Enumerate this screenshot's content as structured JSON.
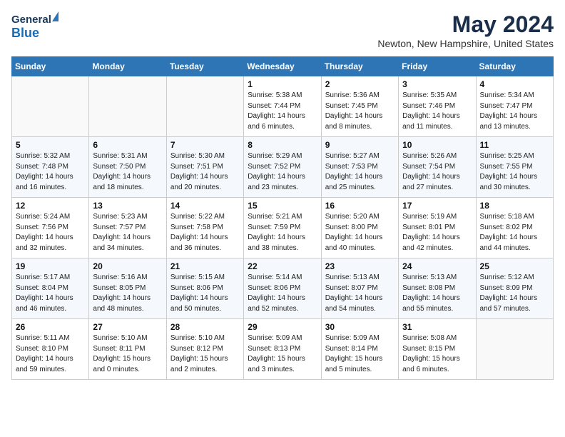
{
  "header": {
    "logo_general": "General",
    "logo_blue": "Blue",
    "month": "May 2024",
    "location": "Newton, New Hampshire, United States"
  },
  "weekdays": [
    "Sunday",
    "Monday",
    "Tuesday",
    "Wednesday",
    "Thursday",
    "Friday",
    "Saturday"
  ],
  "weeks": [
    [
      {
        "day": "",
        "detail": ""
      },
      {
        "day": "",
        "detail": ""
      },
      {
        "day": "",
        "detail": ""
      },
      {
        "day": "1",
        "detail": "Sunrise: 5:38 AM\nSunset: 7:44 PM\nDaylight: 14 hours\nand 6 minutes."
      },
      {
        "day": "2",
        "detail": "Sunrise: 5:36 AM\nSunset: 7:45 PM\nDaylight: 14 hours\nand 8 minutes."
      },
      {
        "day": "3",
        "detail": "Sunrise: 5:35 AM\nSunset: 7:46 PM\nDaylight: 14 hours\nand 11 minutes."
      },
      {
        "day": "4",
        "detail": "Sunrise: 5:34 AM\nSunset: 7:47 PM\nDaylight: 14 hours\nand 13 minutes."
      }
    ],
    [
      {
        "day": "5",
        "detail": "Sunrise: 5:32 AM\nSunset: 7:48 PM\nDaylight: 14 hours\nand 16 minutes."
      },
      {
        "day": "6",
        "detail": "Sunrise: 5:31 AM\nSunset: 7:50 PM\nDaylight: 14 hours\nand 18 minutes."
      },
      {
        "day": "7",
        "detail": "Sunrise: 5:30 AM\nSunset: 7:51 PM\nDaylight: 14 hours\nand 20 minutes."
      },
      {
        "day": "8",
        "detail": "Sunrise: 5:29 AM\nSunset: 7:52 PM\nDaylight: 14 hours\nand 23 minutes."
      },
      {
        "day": "9",
        "detail": "Sunrise: 5:27 AM\nSunset: 7:53 PM\nDaylight: 14 hours\nand 25 minutes."
      },
      {
        "day": "10",
        "detail": "Sunrise: 5:26 AM\nSunset: 7:54 PM\nDaylight: 14 hours\nand 27 minutes."
      },
      {
        "day": "11",
        "detail": "Sunrise: 5:25 AM\nSunset: 7:55 PM\nDaylight: 14 hours\nand 30 minutes."
      }
    ],
    [
      {
        "day": "12",
        "detail": "Sunrise: 5:24 AM\nSunset: 7:56 PM\nDaylight: 14 hours\nand 32 minutes."
      },
      {
        "day": "13",
        "detail": "Sunrise: 5:23 AM\nSunset: 7:57 PM\nDaylight: 14 hours\nand 34 minutes."
      },
      {
        "day": "14",
        "detail": "Sunrise: 5:22 AM\nSunset: 7:58 PM\nDaylight: 14 hours\nand 36 minutes."
      },
      {
        "day": "15",
        "detail": "Sunrise: 5:21 AM\nSunset: 7:59 PM\nDaylight: 14 hours\nand 38 minutes."
      },
      {
        "day": "16",
        "detail": "Sunrise: 5:20 AM\nSunset: 8:00 PM\nDaylight: 14 hours\nand 40 minutes."
      },
      {
        "day": "17",
        "detail": "Sunrise: 5:19 AM\nSunset: 8:01 PM\nDaylight: 14 hours\nand 42 minutes."
      },
      {
        "day": "18",
        "detail": "Sunrise: 5:18 AM\nSunset: 8:02 PM\nDaylight: 14 hours\nand 44 minutes."
      }
    ],
    [
      {
        "day": "19",
        "detail": "Sunrise: 5:17 AM\nSunset: 8:04 PM\nDaylight: 14 hours\nand 46 minutes."
      },
      {
        "day": "20",
        "detail": "Sunrise: 5:16 AM\nSunset: 8:05 PM\nDaylight: 14 hours\nand 48 minutes."
      },
      {
        "day": "21",
        "detail": "Sunrise: 5:15 AM\nSunset: 8:06 PM\nDaylight: 14 hours\nand 50 minutes."
      },
      {
        "day": "22",
        "detail": "Sunrise: 5:14 AM\nSunset: 8:06 PM\nDaylight: 14 hours\nand 52 minutes."
      },
      {
        "day": "23",
        "detail": "Sunrise: 5:13 AM\nSunset: 8:07 PM\nDaylight: 14 hours\nand 54 minutes."
      },
      {
        "day": "24",
        "detail": "Sunrise: 5:13 AM\nSunset: 8:08 PM\nDaylight: 14 hours\nand 55 minutes."
      },
      {
        "day": "25",
        "detail": "Sunrise: 5:12 AM\nSunset: 8:09 PM\nDaylight: 14 hours\nand 57 minutes."
      }
    ],
    [
      {
        "day": "26",
        "detail": "Sunrise: 5:11 AM\nSunset: 8:10 PM\nDaylight: 14 hours\nand 59 minutes."
      },
      {
        "day": "27",
        "detail": "Sunrise: 5:10 AM\nSunset: 8:11 PM\nDaylight: 15 hours\nand 0 minutes."
      },
      {
        "day": "28",
        "detail": "Sunrise: 5:10 AM\nSunset: 8:12 PM\nDaylight: 15 hours\nand 2 minutes."
      },
      {
        "day": "29",
        "detail": "Sunrise: 5:09 AM\nSunset: 8:13 PM\nDaylight: 15 hours\nand 3 minutes."
      },
      {
        "day": "30",
        "detail": "Sunrise: 5:09 AM\nSunset: 8:14 PM\nDaylight: 15 hours\nand 5 minutes."
      },
      {
        "day": "31",
        "detail": "Sunrise: 5:08 AM\nSunset: 8:15 PM\nDaylight: 15 hours\nand 6 minutes."
      },
      {
        "day": "",
        "detail": ""
      }
    ]
  ]
}
